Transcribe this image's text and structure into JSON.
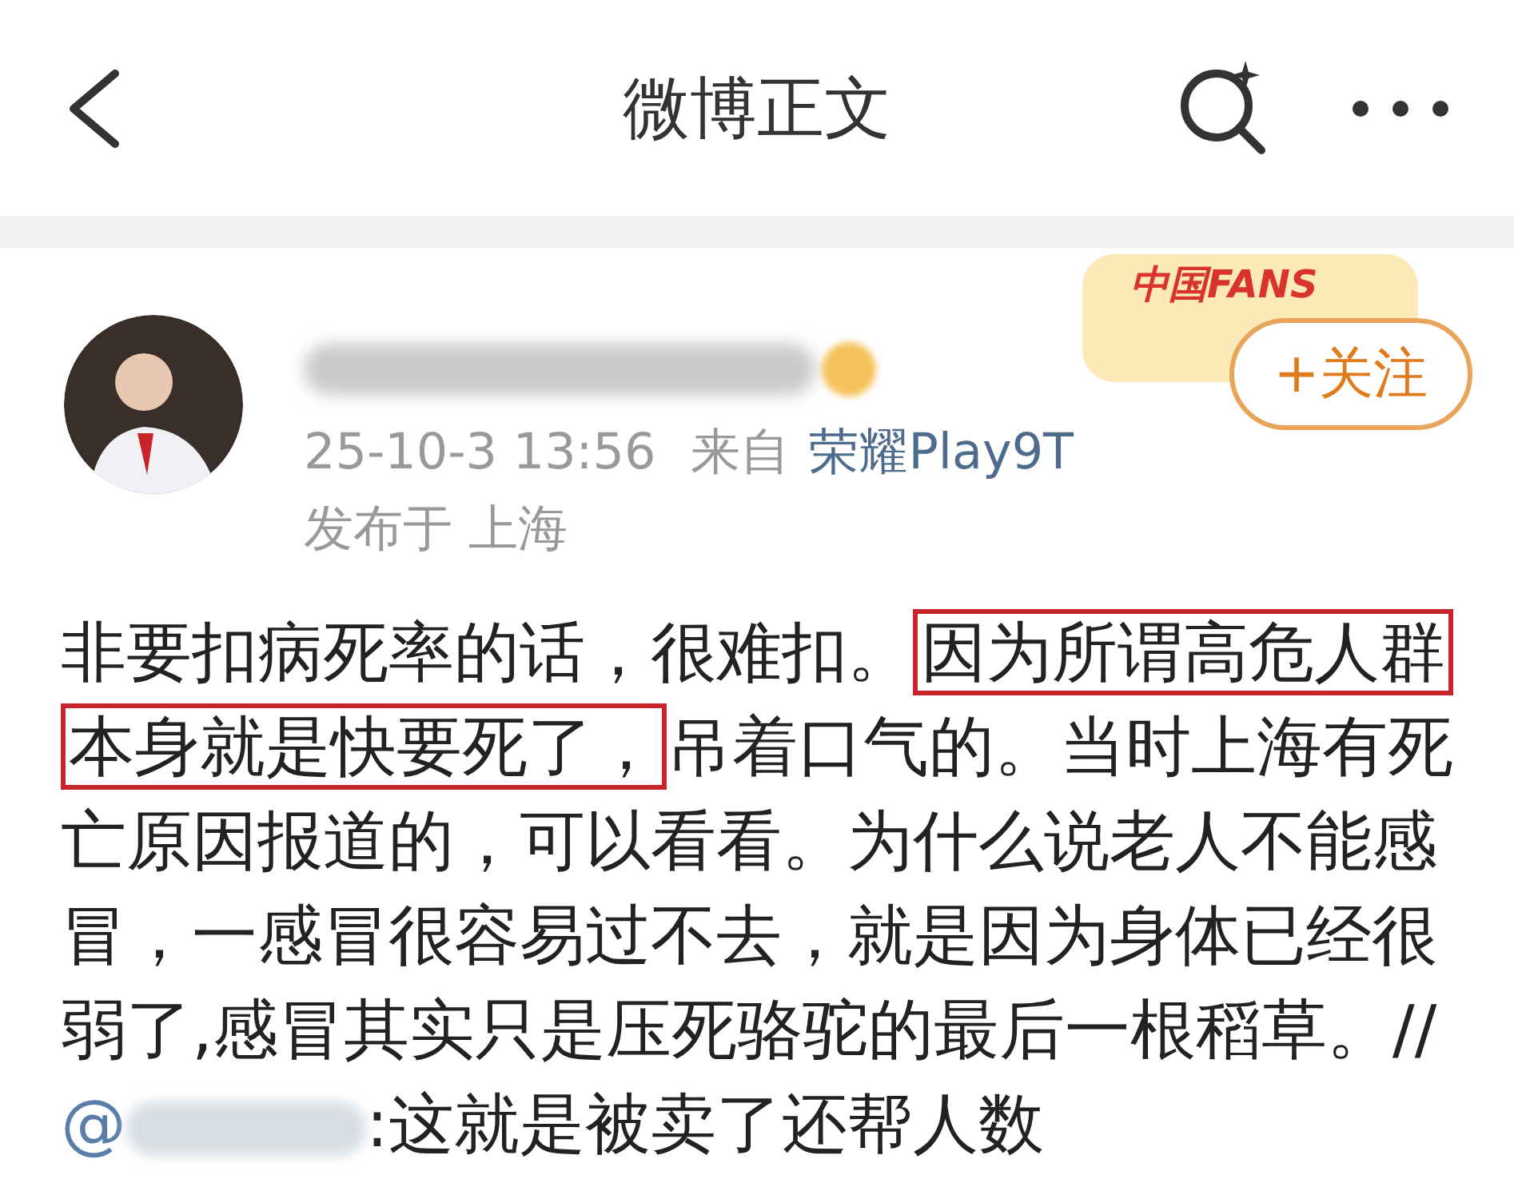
{
  "header": {
    "title": "微博正文"
  },
  "post": {
    "fan_badge": "中国FANS",
    "follow_button": "+关注",
    "time": "25-10-3 13:56",
    "source_prefix": "来自",
    "source": "荣耀Play9T",
    "location": "发布于 上海",
    "body": [
      {
        "kind": "text",
        "text": "非要扣病死率的话，很难扣。"
      },
      {
        "kind": "boxed",
        "text": "因为所谓高危人群本身就是快要死了，"
      },
      {
        "kind": "text",
        "text": "吊着口气的。当时上海有死亡原因报道的，可以看看。为什么说老人不能感冒，一感冒很容易过不去，就是因为身体已经很弱了,感冒其实只是压死骆驼的最后一根稻草。//"
      },
      {
        "kind": "mention",
        "text": "@"
      },
      {
        "kind": "blurred"
      },
      {
        "kind": "text",
        "text": ":这就是被卖了还帮人数"
      }
    ]
  }
}
